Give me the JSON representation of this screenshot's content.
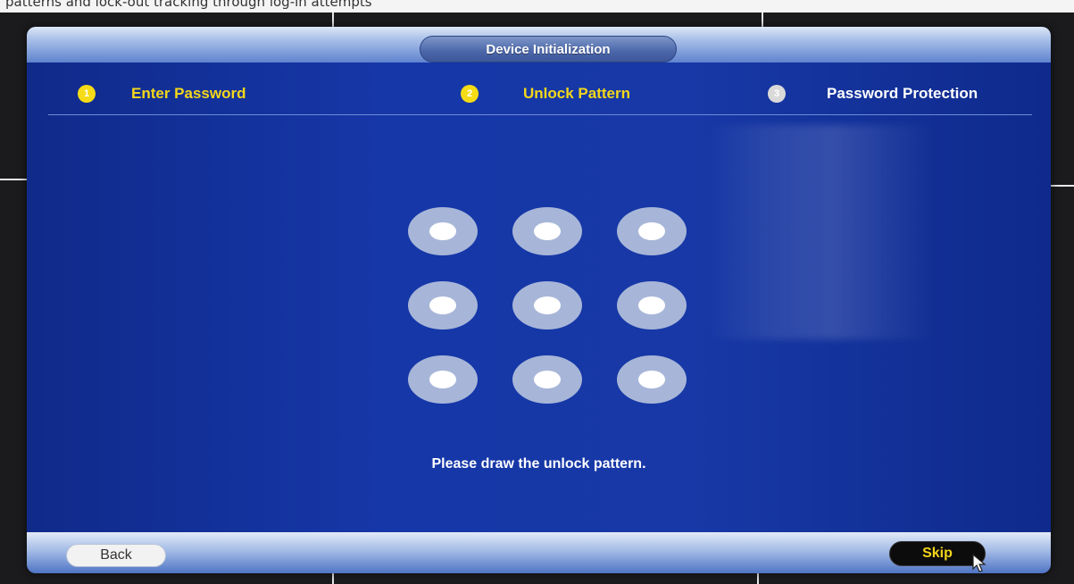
{
  "caption": "patterns and lock-out tracking through log-in attempts",
  "window": {
    "title": "Device Initialization"
  },
  "steps": [
    {
      "number": "1",
      "label": "Enter Password",
      "state": "done"
    },
    {
      "number": "2",
      "label": "Unlock Pattern",
      "state": "active"
    },
    {
      "number": "3",
      "label": "Password Protection",
      "state": "pending"
    }
  ],
  "pattern": {
    "rows": 3,
    "cols": 3,
    "selected": []
  },
  "instruction": "Please draw the unlock pattern.",
  "buttons": {
    "back": "Back",
    "skip": "Skip"
  },
  "colors": {
    "background_blue": "#1637a8",
    "active_step": "#f3d71a",
    "pattern_node": "#a7b6d8"
  },
  "icons": {
    "cursor": "mouse-pointer-icon"
  }
}
